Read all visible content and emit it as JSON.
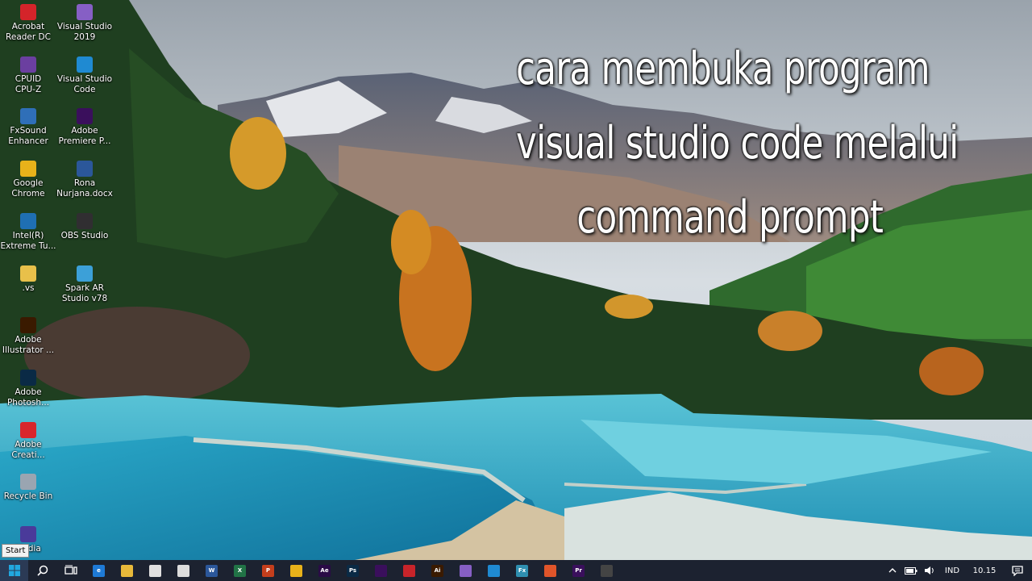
{
  "caption": {
    "line1": "cara membuka program",
    "line2": "visual studio code melalui",
    "line3": "command prompt"
  },
  "desktop_icons": [
    {
      "label": "Acrobat\nReader DC",
      "icon": "acrobat-reader-icon",
      "color": "#d4242a"
    },
    {
      "label": "Visual Studio\n2019",
      "icon": "visual-studio-icon",
      "color": "#865fc5"
    },
    {
      "label": "CPUID\nCPU-Z",
      "icon": "cpuz-icon",
      "color": "#6b3fa0"
    },
    {
      "label": "Visual Studio\nCode",
      "icon": "vscode-icon",
      "color": "#1f8ad2"
    },
    {
      "label": "FxSound\nEnhancer",
      "icon": "fxsound-icon",
      "color": "#2f6fb8"
    },
    {
      "label": "Adobe\nPremiere P...",
      "icon": "premiere-icon",
      "color": "#3a0f5c"
    },
    {
      "label": "Google\nChrome",
      "icon": "chrome-icon",
      "color": "#e8b21a"
    },
    {
      "label": "Rona\nNurjana.docx",
      "icon": "word-doc-icon",
      "color": "#2b579a"
    },
    {
      "label": "Intel(R)\nExtreme Tu...",
      "icon": "intel-xtu-icon",
      "color": "#1f6fb3"
    },
    {
      "label": "OBS Studio",
      "icon": "obs-icon",
      "color": "#302e31"
    },
    {
      "label": ".vs",
      "icon": "folder-icon",
      "color": "#e8c04a"
    },
    {
      "label": "Spark AR\nStudio v78",
      "icon": "spark-ar-icon",
      "color": "#3ca0d8"
    },
    {
      "label": "Adobe\nIllustrator ...",
      "icon": "illustrator-icon",
      "color": "#3a1a00"
    },
    {
      "label": "Adobe\nPhotosh...",
      "icon": "photoshop-icon",
      "color": "#0a2a45"
    },
    {
      "label": "Adobe\nCreati...",
      "icon": "creative-cloud-icon",
      "color": "#d8262c"
    },
    {
      "label": "Recycle Bin",
      "icon": "recycle-bin-icon",
      "color": "#9aa5b1"
    },
    {
      "label": "Media",
      "icon": "media-icon",
      "color": "#4a3a9a"
    }
  ],
  "start_tooltip": "Start",
  "taskbar": {
    "start_icon": "windows-start-icon",
    "search_icon": "search-icon",
    "taskview_icon": "task-view-icon",
    "apps": [
      {
        "name": "edge-icon",
        "glyph": "e",
        "color": "#1e7ad6"
      },
      {
        "name": "file-explorer-icon",
        "glyph": "",
        "color": "#e8b93a"
      },
      {
        "name": "store-icon",
        "glyph": "",
        "color": "#e0e0e0"
      },
      {
        "name": "mail-icon",
        "glyph": "",
        "color": "#dcdcdc"
      },
      {
        "name": "word-icon",
        "glyph": "W",
        "color": "#2b579a"
      },
      {
        "name": "excel-icon",
        "glyph": "X",
        "color": "#217346"
      },
      {
        "name": "powerpoint-icon",
        "glyph": "P",
        "color": "#c43e1c"
      },
      {
        "name": "chrome-icon",
        "glyph": "",
        "color": "#e8b21a"
      },
      {
        "name": "after-effects-icon",
        "glyph": "Ae",
        "color": "#2a0b46"
      },
      {
        "name": "photoshop-icon",
        "glyph": "Ps",
        "color": "#0a2a45"
      },
      {
        "name": "premiere-icon",
        "glyph": "",
        "color": "#3a0f5c"
      },
      {
        "name": "acrobat-icon",
        "glyph": "",
        "color": "#c8242a"
      },
      {
        "name": "illustrator-icon",
        "glyph": "Ai",
        "color": "#3a1a00"
      },
      {
        "name": "visual-studio-icon",
        "glyph": "",
        "color": "#865fc5"
      },
      {
        "name": "vscode-icon",
        "glyph": "",
        "color": "#1f8ad2"
      },
      {
        "name": "fxsound-icon",
        "glyph": "Fx",
        "color": "#2f8fb0"
      },
      {
        "name": "app-orange-icon",
        "glyph": "",
        "color": "#e0552a"
      },
      {
        "name": "premiere-pro-icon",
        "glyph": "Pr",
        "color": "#3a0f5c"
      },
      {
        "name": "obs-icon",
        "glyph": "",
        "color": "#444444"
      }
    ]
  },
  "tray": {
    "language": "IND",
    "time": "10.15"
  }
}
